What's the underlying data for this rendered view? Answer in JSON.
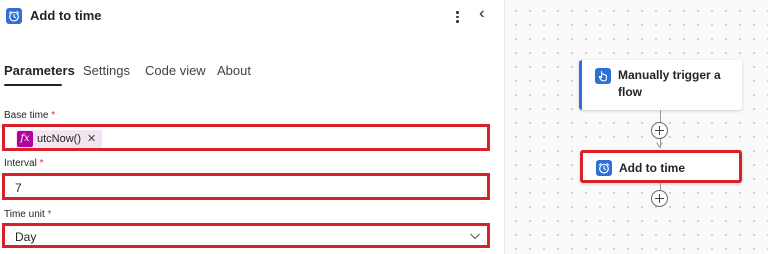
{
  "header": {
    "title": "Add to time",
    "icon": "alarm-clock-icon",
    "more_icon": "more-vertical-icon",
    "collapse_icon": "double-chevron-left-icon"
  },
  "tabs": [
    {
      "label": "Parameters",
      "active": true
    },
    {
      "label": "Settings",
      "active": false
    },
    {
      "label": "Code view",
      "active": false
    },
    {
      "label": "About",
      "active": false
    }
  ],
  "fields": {
    "base_time": {
      "label": "Base time",
      "required_mark": "*",
      "token_icon": "fx",
      "token_label": "utcNow()",
      "remove_glyph": "✕"
    },
    "interval": {
      "label": "Interval",
      "required_mark": "*",
      "value": "7"
    },
    "time_unit": {
      "label": "Time unit",
      "required_mark": "*",
      "value": "Day"
    }
  },
  "canvas": {
    "trigger_card": {
      "title": "Manually trigger a flow",
      "icon": "hand-touch-icon"
    },
    "action_card": {
      "title": "Add to time",
      "icon": "alarm-clock-icon"
    },
    "add_step_icon": "plus-circle-icon"
  },
  "colors": {
    "accent": "#2f6fd8",
    "highlight_border": "#d9212a",
    "fx_token": "#b4009e",
    "fx_token_bg": "#f4e4f2"
  }
}
